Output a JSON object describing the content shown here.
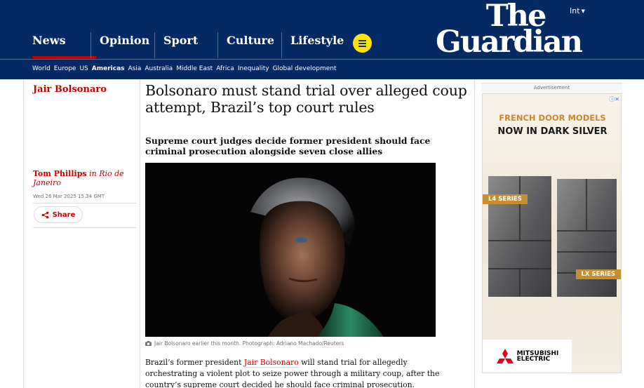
{
  "header": {
    "edition": "Int",
    "logo_line1": "The",
    "logo_line2": "Guardian",
    "pillars": [
      "News",
      "Opinion",
      "Sport",
      "Culture",
      "Lifestyle"
    ],
    "subnav": [
      "World",
      "Europe",
      "US",
      "Americas",
      "Asia",
      "Australia",
      "Middle East",
      "Africa",
      "Inequality",
      "Global development"
    ],
    "active_subnav": "Americas",
    "colors": {
      "brand": "#052962",
      "news_accent": "#c70000",
      "menu_button": "#ffe500"
    }
  },
  "article": {
    "series": "Jair Bolsonaro",
    "headline": "Bolsonaro must stand trial over alleged coup attempt, Brazil’s top court rules",
    "standfirst": "Supreme court judges decide former president should face criminal prosecution alongside seven close allies",
    "author": "Tom Phillips",
    "author_location": "in Rio de Janeiro",
    "date": "Wed 26 Mar 2025 15.34 GMT",
    "share_label": "Share",
    "caption": "Jair Bolsonaro earlier this month. Photograph: Adriano Machado/Reuters",
    "body_pre": "Brazil’s former president",
    "body_link": "Jair Bolsonaro",
    "body_post": "will stand trial for allegedly orchestrating a violent plot to seize power through a military coup, after the country’s supreme court decided he should face criminal prosecution."
  },
  "advert": {
    "label": "Advertisement",
    "line1": "FRENCH DOOR MODELS",
    "line2": "NOW IN DARK SILVER",
    "tag1": "L4 SERIES",
    "tag2": "LX SERIES",
    "brand_line1": "MITSUBISHI",
    "brand_line2": "ELECTRIC"
  }
}
